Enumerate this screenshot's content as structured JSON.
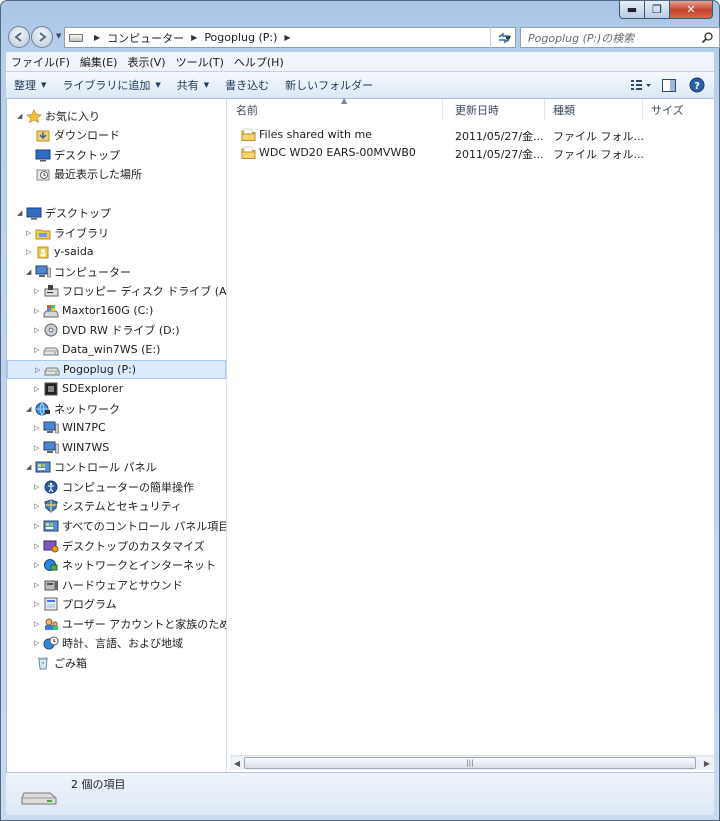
{
  "window": {
    "controls": {
      "minimize": "▬",
      "maximize": "❐",
      "close": "✕"
    }
  },
  "address": {
    "segments": [
      "コンピューター",
      "Pogoplug (P:)"
    ],
    "search_placeholder": "Pogoplug (P:)の検索"
  },
  "menu": [
    "ファイル(F)",
    "編集(E)",
    "表示(V)",
    "ツール(T)",
    "ヘルプ(H)"
  ],
  "commands": [
    {
      "label": "整理",
      "dropdown": true
    },
    {
      "label": "ライブラリに追加",
      "dropdown": true
    },
    {
      "label": "共有",
      "dropdown": true
    },
    {
      "label": "書き込む",
      "dropdown": false
    },
    {
      "label": "新しいフォルダー",
      "dropdown": false
    }
  ],
  "tree": [
    {
      "label": "お気に入り",
      "icon": "star-icon",
      "expand": "expanded"
    },
    {
      "label": "ダウンロード",
      "icon": "download-folder-icon",
      "expand": "none"
    },
    {
      "label": "デスクトップ",
      "icon": "desktop-icon",
      "expand": "none"
    },
    {
      "label": "最近表示した場所",
      "icon": "recent-places-icon",
      "expand": "none"
    },
    {
      "label": "デスクトップ",
      "icon": "desktop-icon",
      "expand": "expanded"
    },
    {
      "label": "ライブラリ",
      "icon": "library-icon",
      "expand": "collapsed"
    },
    {
      "label": "y-saida",
      "icon": "user-folder-icon",
      "expand": "collapsed"
    },
    {
      "label": "コンピューター",
      "icon": "computer-icon",
      "expand": "expanded"
    },
    {
      "label": "フロッピー ディスク ドライブ (A:)",
      "icon": "floppy-drive-icon",
      "expand": "collapsed"
    },
    {
      "label": "Maxtor160G (C:)",
      "icon": "system-drive-icon",
      "expand": "collapsed"
    },
    {
      "label": "DVD RW ドライブ (D:)",
      "icon": "dvd-drive-icon",
      "expand": "collapsed"
    },
    {
      "label": "Data_win7WS (E:)",
      "icon": "drive-icon",
      "expand": "collapsed"
    },
    {
      "label": "Pogoplug (P:)",
      "icon": "drive-icon",
      "expand": "collapsed",
      "selected": true
    },
    {
      "label": "SDExplorer",
      "icon": "sdexplorer-icon",
      "expand": "collapsed"
    },
    {
      "label": "ネットワーク",
      "icon": "network-icon",
      "expand": "expanded"
    },
    {
      "label": "WIN7PC",
      "icon": "pc-icon",
      "expand": "collapsed"
    },
    {
      "label": "WIN7WS",
      "icon": "pc-icon",
      "expand": "collapsed"
    },
    {
      "label": "コントロール パネル",
      "icon": "control-panel-icon",
      "expand": "expanded"
    },
    {
      "label": "コンピューターの簡単操作",
      "icon": "ease-of-access-icon",
      "expand": "collapsed"
    },
    {
      "label": "システムとセキュリティ",
      "icon": "security-icon",
      "expand": "collapsed"
    },
    {
      "label": "すべてのコントロール パネル項目",
      "icon": "control-panel-items-icon",
      "expand": "collapsed"
    },
    {
      "label": "デスクトップのカスタマイズ",
      "icon": "personalization-icon",
      "expand": "collapsed"
    },
    {
      "label": "ネットワークとインターネット",
      "icon": "network-internet-icon",
      "expand": "collapsed"
    },
    {
      "label": "ハードウェアとサウンド",
      "icon": "hardware-sound-icon",
      "expand": "collapsed"
    },
    {
      "label": "プログラム",
      "icon": "programs-icon",
      "expand": "collapsed"
    },
    {
      "label": "ユーザー アカウントと家族のための安",
      "icon": "user-accounts-icon",
      "expand": "collapsed"
    },
    {
      "label": "時計、言語、および地域",
      "icon": "clock-language-icon",
      "expand": "collapsed"
    },
    {
      "label": "ごみ箱",
      "icon": "recycle-bin-icon",
      "expand": "none"
    }
  ],
  "columns": [
    "名前",
    "更新日時",
    "種類",
    "サイズ"
  ],
  "files": [
    {
      "name": "Files shared with me",
      "modified": "2011/05/27/金...",
      "type": "ファイル フォル..."
    },
    {
      "name": "WDC WD20 EARS-00MVWB0",
      "modified": "2011/05/27/金...",
      "type": "ファイル フォル..."
    }
  ],
  "status": {
    "item_count": "2 個の項目"
  },
  "colors": {
    "selection": "#ddecfc",
    "frame": "#b8d0ec",
    "link": "#1e395b"
  }
}
